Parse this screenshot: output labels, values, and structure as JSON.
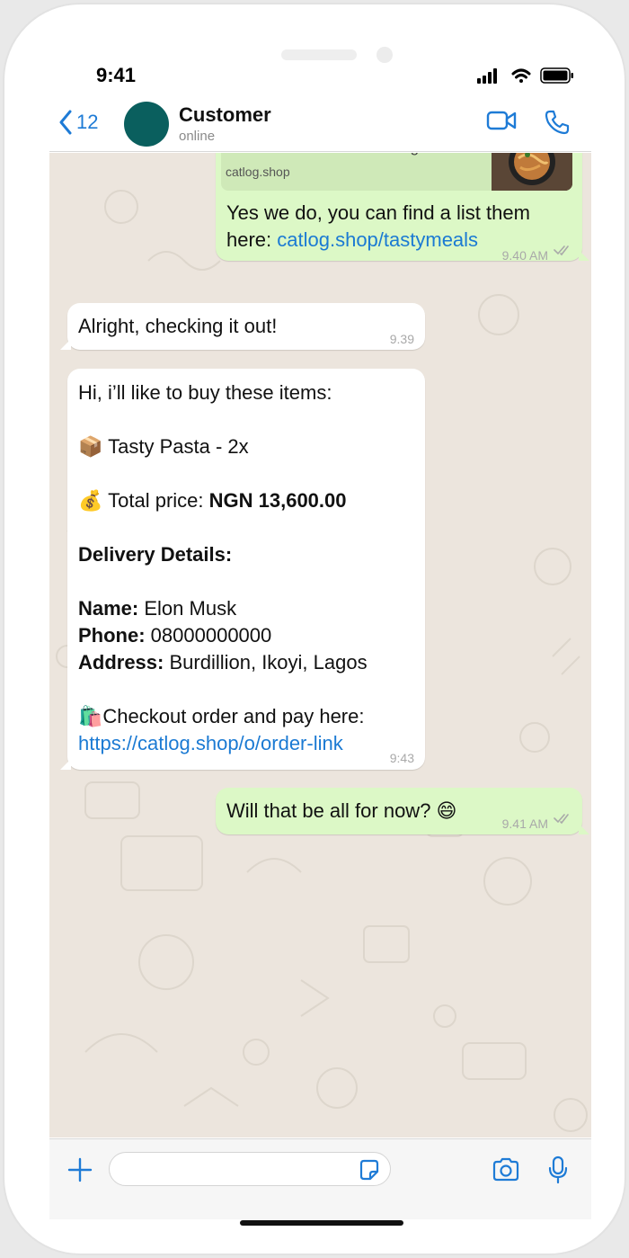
{
  "status_bar": {
    "time": "9:41"
  },
  "header": {
    "back_count": "12",
    "contact_name": "Customer",
    "contact_status": "online",
    "icons": [
      "chevron-left-icon",
      "video-call-icon",
      "phone-call-icon"
    ]
  },
  "messages": [
    {
      "direction": "outgoing",
      "link_preview": {
        "description": "We sell the best meals in lagos",
        "host": "catlog.shop"
      },
      "text": "Yes we do, you can find a list them here: ",
      "text_line1": "Yes we do, you can find a list them",
      "text_line2_prefix": "here: ",
      "link": "catlog.shop/tastymeals",
      "time": "9.40 AM",
      "ticks": "double-check-icon"
    },
    {
      "direction": "incoming",
      "text": "Alright, checking it out!",
      "time": "9.39"
    },
    {
      "direction": "incoming",
      "greeting": "Hi, i’ll like to buy these items:",
      "item_emoji": "📦",
      "item": "Tasty Pasta - 2x",
      "total_emoji": "💰",
      "total_label": "Total price: ",
      "total_value": "NGN 13,600.00",
      "delivery_heading": "Delivery Details:",
      "name_label": "Name:",
      "name_value": " Elon Musk",
      "phone_label": "Phone:",
      "phone_value": " 08000000000",
      "address_label": "Address:",
      "address_value": " Burdillion, Ikoyi, Lagos",
      "checkout_emoji": "🛍️",
      "checkout_text": "Checkout order and pay here:",
      "checkout_link": "https://catlog.shop/o/order-link",
      "time": "9:43"
    },
    {
      "direction": "outgoing",
      "text": "Will that be all for now? 😄",
      "time": "9.41 AM",
      "ticks": "double-check-icon"
    }
  ],
  "composer": {
    "input_value": "",
    "icons": [
      "plus-icon",
      "sticker-icon",
      "camera-icon",
      "microphone-icon"
    ]
  },
  "colors": {
    "accent": "#1e7bd6",
    "outgoing_bubble": "#dcf8c6",
    "incoming_bubble": "#ffffff",
    "chat_bg": "#ece5dd",
    "avatar": "#0a5f5e"
  }
}
